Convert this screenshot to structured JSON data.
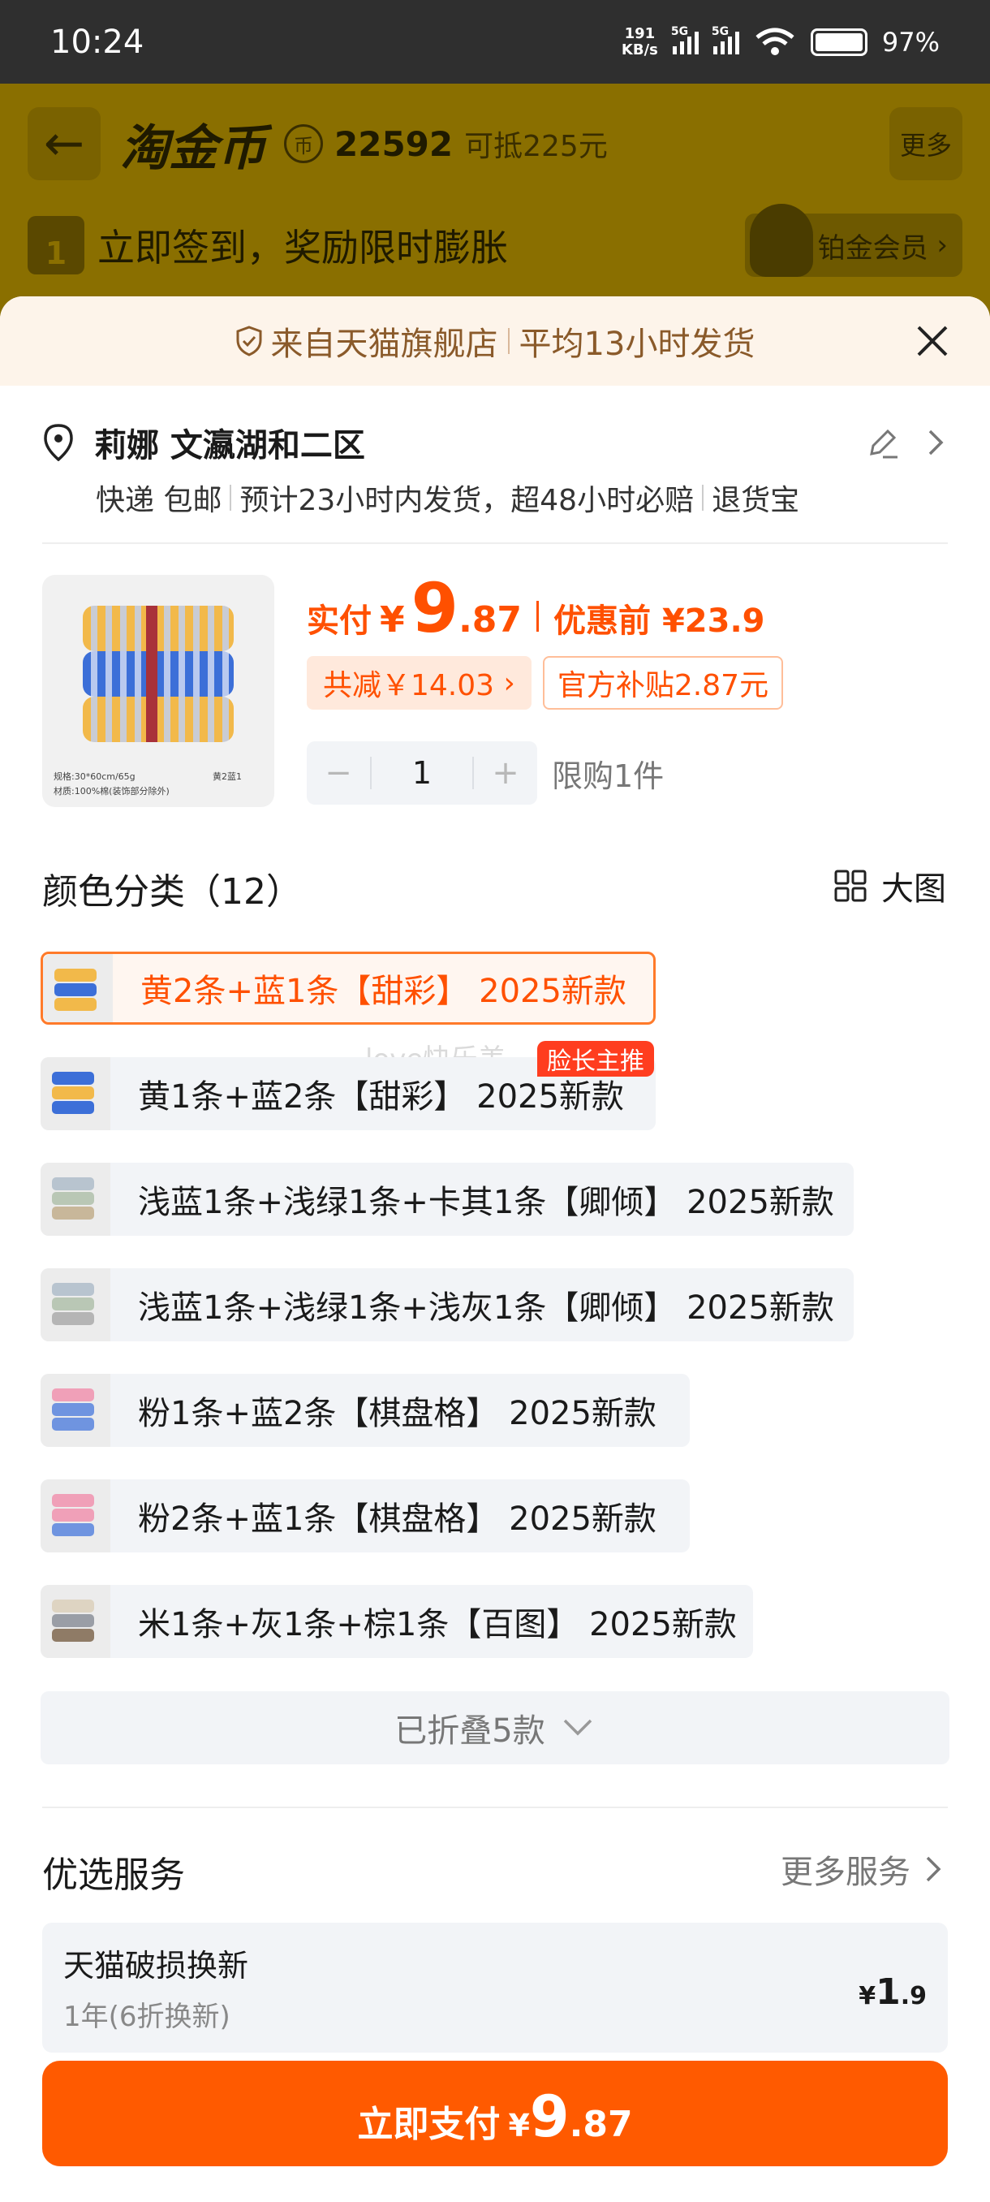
{
  "status_bar": {
    "time": "10:24",
    "speed_value": "191",
    "speed_unit": "KB/s",
    "net1": "5G",
    "net2": "5G",
    "battery": "97%"
  },
  "background_app": {
    "title": "淘金币",
    "coin_symbol": "币",
    "coins": "22592",
    "coin_value": "可抵225元",
    "more": "更多",
    "calendar_day": "1",
    "signin_text": "立即签到，奖励限时膨胀",
    "member": "铂金会员"
  },
  "banner": {
    "left": "来自天猫旗舰店",
    "right": "平均13小时发货"
  },
  "address": {
    "name": "莉娜 文瀛湖和二区",
    "shipping": "快递 包邮",
    "eta": "预计23小时内发货，超48小时必赔",
    "returns": "退货宝"
  },
  "product": {
    "pay_label": "实付",
    "currency": "¥",
    "price_int": "9",
    "price_dec": ".87",
    "pre_discount": "优惠前 ¥23.9",
    "saving": "共减￥14.03",
    "subsidy": "官方补贴2.87元",
    "qty": "1",
    "limit": "限购1件",
    "thumb_caption1": "规格:30*60cm/65g",
    "thumb_caption2": "材质:100%棉(装饰部分除外)",
    "thumb_caption3": "黄2蓝1"
  },
  "colors": {
    "title": "颜色分类（12）",
    "big_view": "大图",
    "watermark": "love快乐美",
    "badge": "脸长主推",
    "options": [
      {
        "label": "黄2条+蓝1条【甜彩】 2025新款",
        "selected": true
      },
      {
        "label": "黄1条+蓝2条【甜彩】 2025新款",
        "selected": false
      },
      {
        "label": "浅蓝1条+浅绿1条+卡其1条【卿倾】 2025新款",
        "selected": false
      },
      {
        "label": "浅蓝1条+浅绿1条+浅灰1条【卿倾】 2025新款",
        "selected": false
      },
      {
        "label": "粉1条+蓝2条【棋盘格】 2025新款",
        "selected": false
      },
      {
        "label": "粉2条+蓝1条【棋盘格】 2025新款",
        "selected": false
      },
      {
        "label": "米1条+灰1条+棕1条【百图】 2025新款",
        "selected": false
      }
    ],
    "folded": "已折叠5款"
  },
  "services": {
    "title": "优选服务",
    "more": "更多服务",
    "item_name": "天猫破损换新",
    "item_sub": "1年(6折换新)",
    "item_price_symbol": "¥",
    "item_price_int": "1",
    "item_price_dec": ".9"
  },
  "pay_button": {
    "label": "立即支付",
    "currency": "¥",
    "price_int": "9",
    "price_dec": ".87"
  },
  "accent_color": "#ff5000"
}
